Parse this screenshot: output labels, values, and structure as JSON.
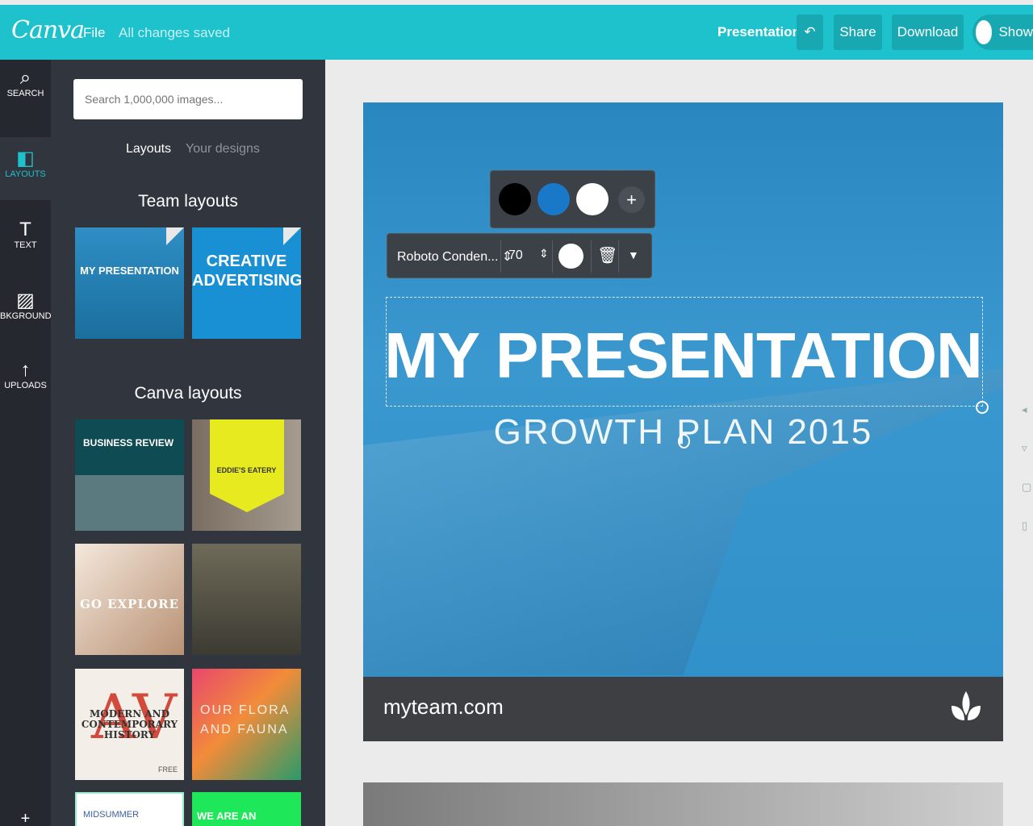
{
  "topbar": {
    "logo": "Canva",
    "file_label": "File",
    "saved_status": "All changes saved",
    "doc_type": "Presentation",
    "undo_icon": "↶",
    "share_label": "Share",
    "download_label": "Download",
    "show_label": "Show",
    "accent_color": "#1dc2cc"
  },
  "rail": {
    "search_label": "SEARCH",
    "search_icon": "⌕",
    "layouts_label": "LAYOUTS",
    "layouts_icon": "◧",
    "text_label": "TEXT",
    "text_icon": "T",
    "background_label": "BKGROUND",
    "background_icon": "▨",
    "uploads_label": "UPLOADS",
    "uploads_icon": "↑",
    "add_icon": "+"
  },
  "panel": {
    "search_placeholder": "Search 1,000,000 images...",
    "tabs": [
      "Layouts",
      "Your designs"
    ],
    "team_title": "Team layouts",
    "canva_title": "Canva layouts",
    "team_layouts": [
      {
        "label": "MY PRESENTATION"
      },
      {
        "label": "CREATIVE ADVERTISING"
      }
    ],
    "canva_layouts": [
      {
        "label": "BUSINESS REVIEW"
      },
      {
        "label": "EDDIE'S EATERY"
      },
      {
        "label": "GO EXPLORE"
      },
      {
        "label": ""
      },
      {
        "label": "MODERN AND CONTEMPORARY HISTORY",
        "big": "AV",
        "badge": "FREE"
      },
      {
        "label": "OUR FLORA AND FAUNA"
      },
      {
        "label": "MIDSUMMER"
      },
      {
        "label": "WE ARE AN"
      }
    ]
  },
  "slide": {
    "title": "MY PRESENTATION",
    "subtitle": "GROWTH PLAN 2015",
    "footer_url": "myteam.com"
  },
  "toolbar": {
    "swatches": [
      "#000000",
      "#1a78c8",
      "#ffffff"
    ],
    "add_icon": "+",
    "font_name": "Roboto Conden...",
    "font_arrow": "⇕",
    "font_size": "70",
    "size_arrow": "⇕",
    "trash_icon": "🗑",
    "caret_icon": "▼"
  }
}
